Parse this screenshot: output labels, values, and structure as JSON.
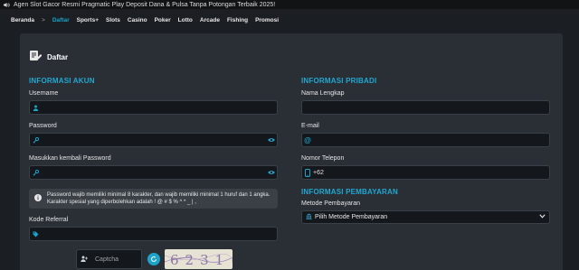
{
  "ticker": {
    "text": "Agen Slot Gacor Resmi Pragmatic Play Deposit Dana & Pulsa Tanpa Potongan Terbaik 2025!"
  },
  "nav": {
    "items": [
      "Beranda",
      ">",
      "Daftar",
      "Sports+",
      "Slots",
      "Casino",
      "Poker",
      "Lotto",
      "Arcade",
      "Fishing",
      "Promosi"
    ],
    "active": "Daftar"
  },
  "form": {
    "title": "Daftar",
    "account": {
      "heading": "INFORMASI AKUN",
      "username_label": "Username",
      "username_value": "",
      "password_label": "Password",
      "password_value": "",
      "confirm_label": "Masukkan kembali Password",
      "confirm_value": "",
      "notice": "Password wajib memiliki minimal 8 karakter, dan wajib memiliki minimal 1 huruf dan 1 angka. Karakter spesial yang diperbolehkan adalah ! @ # $ % ^ * _ | ,",
      "referral_label": "Kode Referral",
      "referral_value": "",
      "captcha_placeholder": "Captcha",
      "captcha_image_text": "6231"
    },
    "personal": {
      "heading": "INFORMASI PRIBADI",
      "fullname_label": "Nama Lengkap",
      "fullname_value": "",
      "email_label": "E-mail",
      "email_value": "",
      "phone_label": "Nomor Telepon",
      "phone_prefix": "+62"
    },
    "payment": {
      "heading": "INFORMASI PEMBAYARAN",
      "method_label": "Metode Pembayaran",
      "method_selected": "Pilih Metode Pembayaran"
    }
  },
  "colors": {
    "accent": "#1ca3c9",
    "panel": "#2a2f36",
    "input": "#14171b"
  }
}
